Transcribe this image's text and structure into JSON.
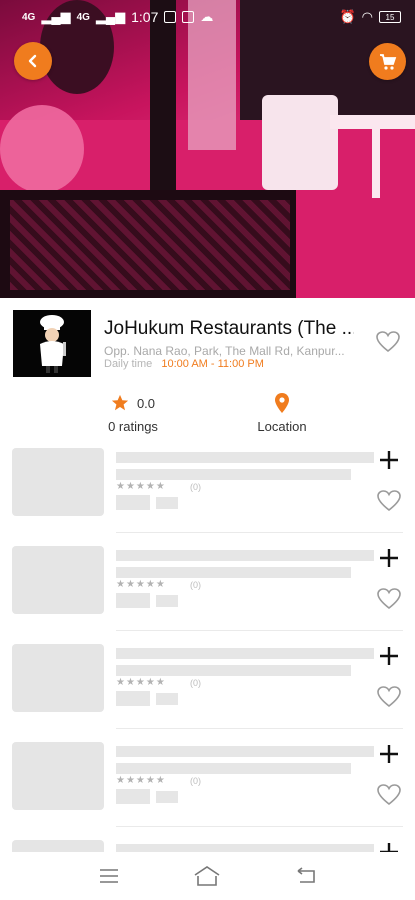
{
  "status_bar": {
    "signal1": "4G",
    "signal2": "4G",
    "time": "1:07",
    "battery": "15"
  },
  "hero": {
    "back_icon": "chevron-left-icon",
    "cart_icon": "shopping-cart-icon",
    "accent": "#f07c1e"
  },
  "restaurant": {
    "name": "JoHukum Restaurants (The ...",
    "address": "Opp. Nana Rao, Park, The Mall Rd, Kanpur...",
    "hours_label": "Daily time",
    "hours": "10:00 AM - 11:00 PM",
    "rating_value": "0.0",
    "ratings_label": "0 ratings",
    "location_label": "Location"
  },
  "list": {
    "items": [
      {
        "count": "(0)"
      },
      {
        "count": "(0)"
      },
      {
        "count": "(0)"
      },
      {
        "count": "(0)"
      }
    ]
  },
  "colors": {
    "accent": "#f07c1e",
    "skeleton": "#e6e6e6"
  }
}
